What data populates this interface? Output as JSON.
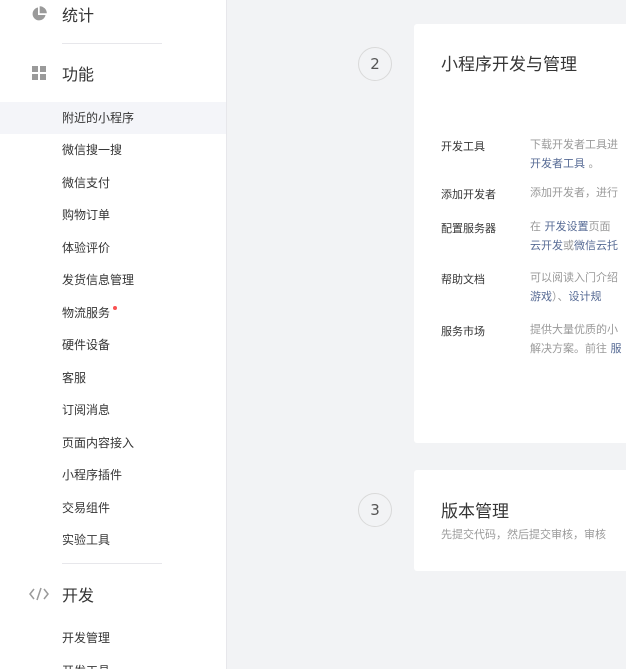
{
  "sidebar": {
    "stats": {
      "label": "统计",
      "icon": "pie-chart-icon"
    },
    "features": {
      "label": "功能",
      "icon": "grid-icon",
      "items": [
        {
          "label": "附近的小程序",
          "active": true
        },
        {
          "label": "微信搜一搜"
        },
        {
          "label": "微信支付"
        },
        {
          "label": "购物订单"
        },
        {
          "label": "体验评价"
        },
        {
          "label": "发货信息管理"
        },
        {
          "label": "物流服务",
          "badge_dot": true
        },
        {
          "label": "硬件设备"
        },
        {
          "label": "客服"
        },
        {
          "label": "订阅消息"
        },
        {
          "label": "页面内容接入"
        },
        {
          "label": "小程序插件"
        },
        {
          "label": "交易组件"
        },
        {
          "label": "实验工具"
        }
      ]
    },
    "dev": {
      "label": "开发",
      "icon": "code-icon",
      "items": [
        {
          "label": "开发管理"
        },
        {
          "label": "开发工具"
        }
      ]
    }
  },
  "steps": [
    {
      "number": "2",
      "title": "小程序开发与管理",
      "rows": [
        {
          "label": "开发工具",
          "line1": "下载开发者工具进",
          "line2_link": "开发者工具",
          "line2_tail": "。"
        },
        {
          "label": "添加开发者",
          "line1": "添加开发者，进行"
        },
        {
          "label": "配置服务器",
          "line1_pre": "在 ",
          "line1_link": "开发设置",
          "line1_post": "页面",
          "line2_link_a": "云开发",
          "line2_mid": "或",
          "line2_link_b": "微信云托"
        },
        {
          "label": "帮助文档",
          "line1": "可以阅读入门介绍",
          "line2_link_a": "游戏",
          "line2_mid": "）、",
          "line2_link_b": "设计规"
        },
        {
          "label": "服务市场",
          "line1": "提供大量优质的小",
          "line2_pre": "解决方案。前往 ",
          "line2_link": "服"
        }
      ]
    },
    {
      "number": "3",
      "title": "版本管理",
      "description": "先提交代码，然后提交审核，审核"
    }
  ],
  "colors": {
    "link": "#576b95",
    "active_bg": "#f4f5f9",
    "badge": "#fa5151"
  }
}
